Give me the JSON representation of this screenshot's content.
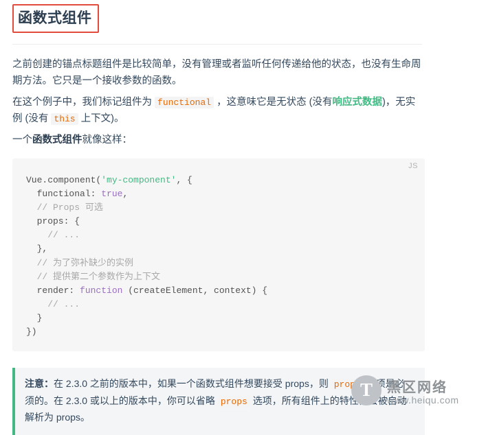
{
  "page": {
    "title": "函数式组件"
  },
  "paragraphs": {
    "p1": "之前创建的锚点标题组件是比较简单，没有管理或者监听任何传递给他的状态，也没有生命周期方法。它只是一个接收参数的函数。",
    "p2_part1": "在这个例子中，我们标记组件为 ",
    "p2_code_functional": "functional",
    "p2_part2": " ，这意味它是无状态 (没有",
    "p2_link": "响应式数据",
    "p2_part3": ")，无实例 (没有 ",
    "p2_code_this": "this",
    "p2_part4": " 上下文)。",
    "p3_part1": "一个",
    "p3_bold": "函数式组件",
    "p3_part2": "就像这样："
  },
  "code_block": {
    "lang_label": "JS",
    "lines": [
      {
        "tokens": [
          {
            "t": "Vue.component(",
            "c": "pun"
          },
          {
            "t": "'my-component'",
            "c": "str"
          },
          {
            "t": ", {",
            "c": "pun"
          }
        ]
      },
      {
        "tokens": [
          {
            "t": "  functional: ",
            "c": "pun"
          },
          {
            "t": "true",
            "c": "kw"
          },
          {
            "t": ",",
            "c": "pun"
          }
        ]
      },
      {
        "tokens": [
          {
            "t": "  // Props 可选",
            "c": "com"
          }
        ]
      },
      {
        "tokens": [
          {
            "t": "  props: {",
            "c": "pun"
          }
        ]
      },
      {
        "tokens": [
          {
            "t": "    // ...",
            "c": "com"
          }
        ]
      },
      {
        "tokens": [
          {
            "t": "  },",
            "c": "pun"
          }
        ]
      },
      {
        "tokens": [
          {
            "t": "  // 为了弥补缺少的实例",
            "c": "com"
          }
        ]
      },
      {
        "tokens": [
          {
            "t": "  // 提供第二个参数作为上下文",
            "c": "com"
          }
        ]
      },
      {
        "tokens": [
          {
            "t": "  render: ",
            "c": "pun"
          },
          {
            "t": "function",
            "c": "kw"
          },
          {
            "t": " (createElement, context) {",
            "c": "pun"
          }
        ]
      },
      {
        "tokens": [
          {
            "t": "    // ...",
            "c": "com"
          }
        ]
      },
      {
        "tokens": [
          {
            "t": "  }",
            "c": "pun"
          }
        ]
      },
      {
        "tokens": [
          {
            "t": "})",
            "c": "pun"
          }
        ]
      }
    ]
  },
  "tip": {
    "label": "注意：",
    "part1": "在 2.3.0 之前的版本中，如果一个函数式组件想要接受 props，则 ",
    "code1": "props",
    "part2": " 选项是必须的。在 2.3.0 或以上的版本中，你可以省略 ",
    "code2": "props",
    "part3": " 选项，所有组件上的特性都会被自动解析为 props。"
  },
  "watermark": {
    "logo_letter": "T",
    "main_text": "黑区网络",
    "sub_text": "www.heiqu.com"
  }
}
